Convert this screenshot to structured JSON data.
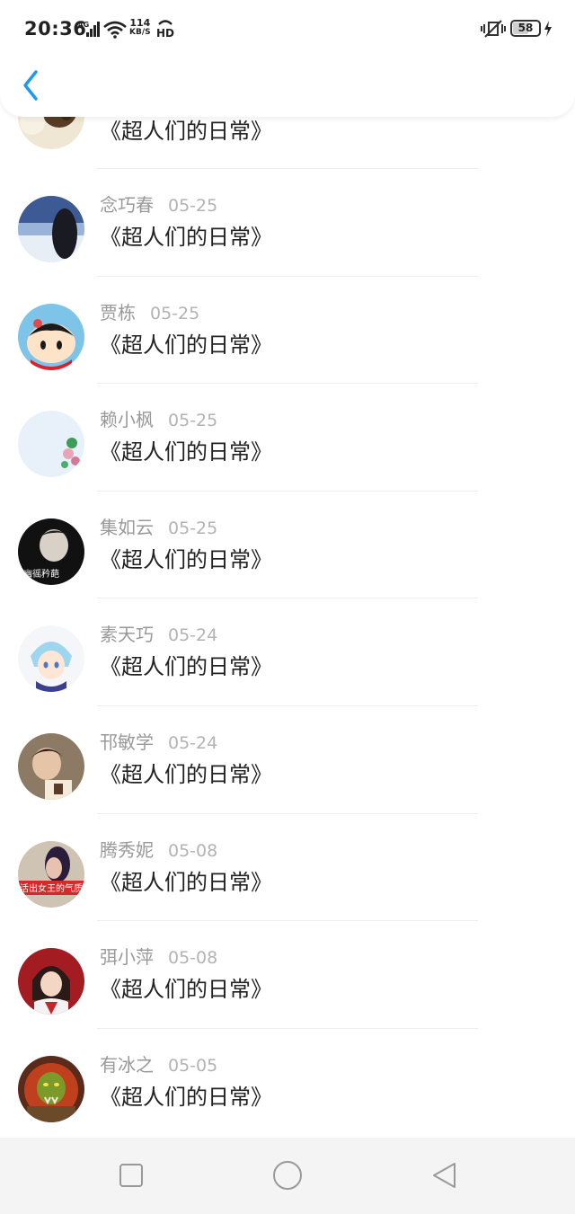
{
  "status_bar": {
    "time": "20:36",
    "network": "4G",
    "net_speed_value": "114",
    "net_speed_unit": "KB/S",
    "hd_label": "HD",
    "battery": "58"
  },
  "header": {
    "back_icon": "chevron-left-icon"
  },
  "partial_item": {
    "title": "《超人们的日常》"
  },
  "items": [
    {
      "name": "念巧春",
      "date": "05-25",
      "title": "《超人们的日常》"
    },
    {
      "name": "贾栋",
      "date": "05-25",
      "title": "《超人们的日常》"
    },
    {
      "name": "赖小枫",
      "date": "05-25",
      "title": "《超人们的日常》"
    },
    {
      "name": "集如云",
      "date": "05-25",
      "title": "《超人们的日常》",
      "avatar_caption": "幽徭矜葩"
    },
    {
      "name": "素天巧",
      "date": "05-24",
      "title": "《超人们的日常》"
    },
    {
      "name": "邗敏学",
      "date": "05-24",
      "title": "《超人们的日常》"
    },
    {
      "name": "腾秀妮",
      "date": "05-08",
      "title": "《超人们的日常》",
      "avatar_caption": "活出女王的气质"
    },
    {
      "name": "弭小萍",
      "date": "05-08",
      "title": "《超人们的日常》"
    },
    {
      "name": "有冰之",
      "date": "05-05",
      "title": "《超人们的日常》"
    }
  ],
  "nav_bar": {
    "recent_icon": "square-icon",
    "home_icon": "circle-icon",
    "back_icon": "triangle-back-icon"
  },
  "colors": {
    "accent": "#1e9bf0",
    "divider": "#eeeeee",
    "meta_text": "#999999",
    "nav_background": "#f4f4f4"
  }
}
